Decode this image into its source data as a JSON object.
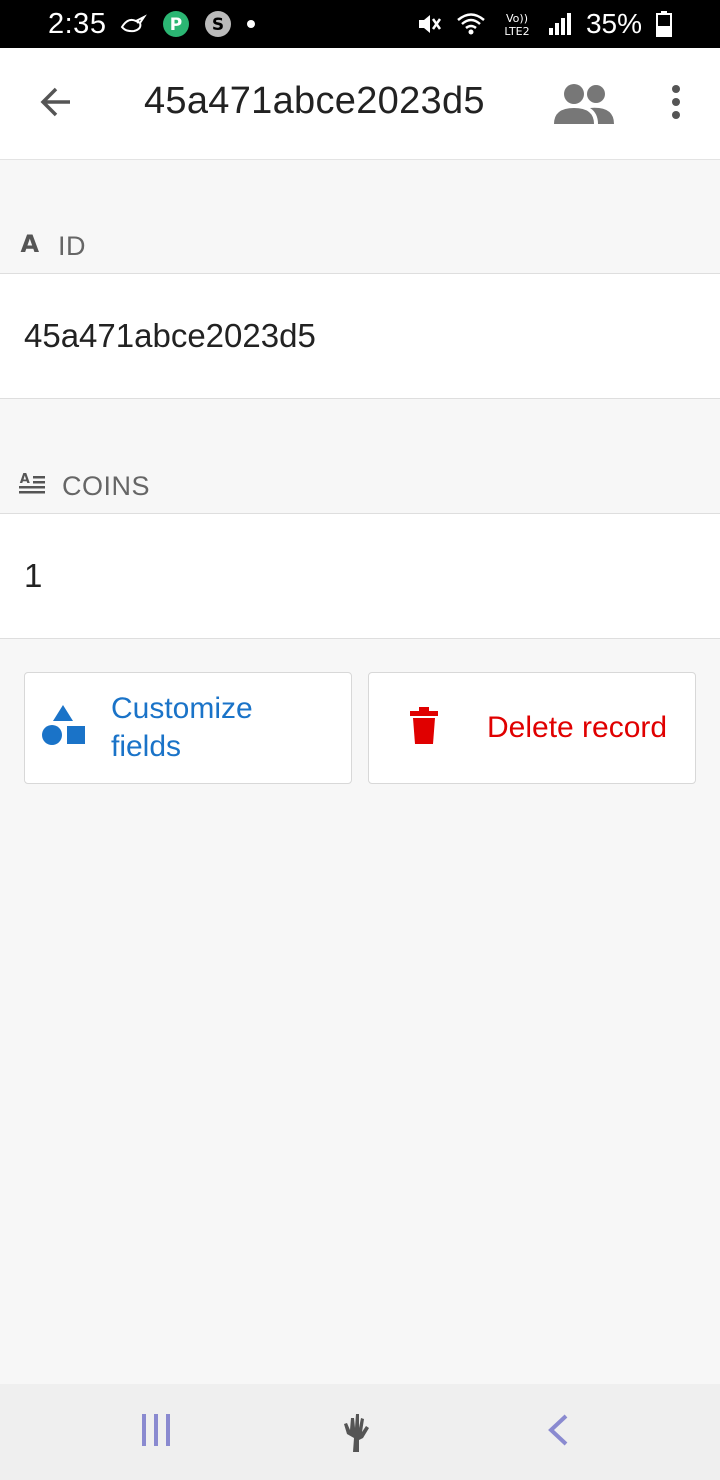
{
  "status_bar": {
    "time": "2:35",
    "battery_percent": "35%",
    "icons": [
      "bird-icon",
      "p-app-icon",
      "s-app-icon",
      "notification-dot-icon",
      "mute-icon",
      "wifi-icon",
      "volte-icon",
      "signal-icon",
      "battery-icon"
    ]
  },
  "app_bar": {
    "title": "45a471abce2023d5",
    "back_icon": "arrow-left-icon",
    "people_icon": "people-icon",
    "more_icon": "more-vert-icon"
  },
  "fields": [
    {
      "label": "ID",
      "icon": "text-a-icon",
      "value": "45a471abce2023d5"
    },
    {
      "label": "COINS",
      "icon": "text-lines-icon",
      "value": "1"
    }
  ],
  "actions": {
    "customize_label": "Customize fields",
    "delete_label": "Delete record"
  },
  "colors": {
    "accent_blue": "#1a73c8",
    "delete_red": "#e00000",
    "nav_purple": "#8a8ad0"
  },
  "nav_bar": {
    "icons": [
      "recents-icon",
      "home-icon",
      "back-icon"
    ]
  }
}
